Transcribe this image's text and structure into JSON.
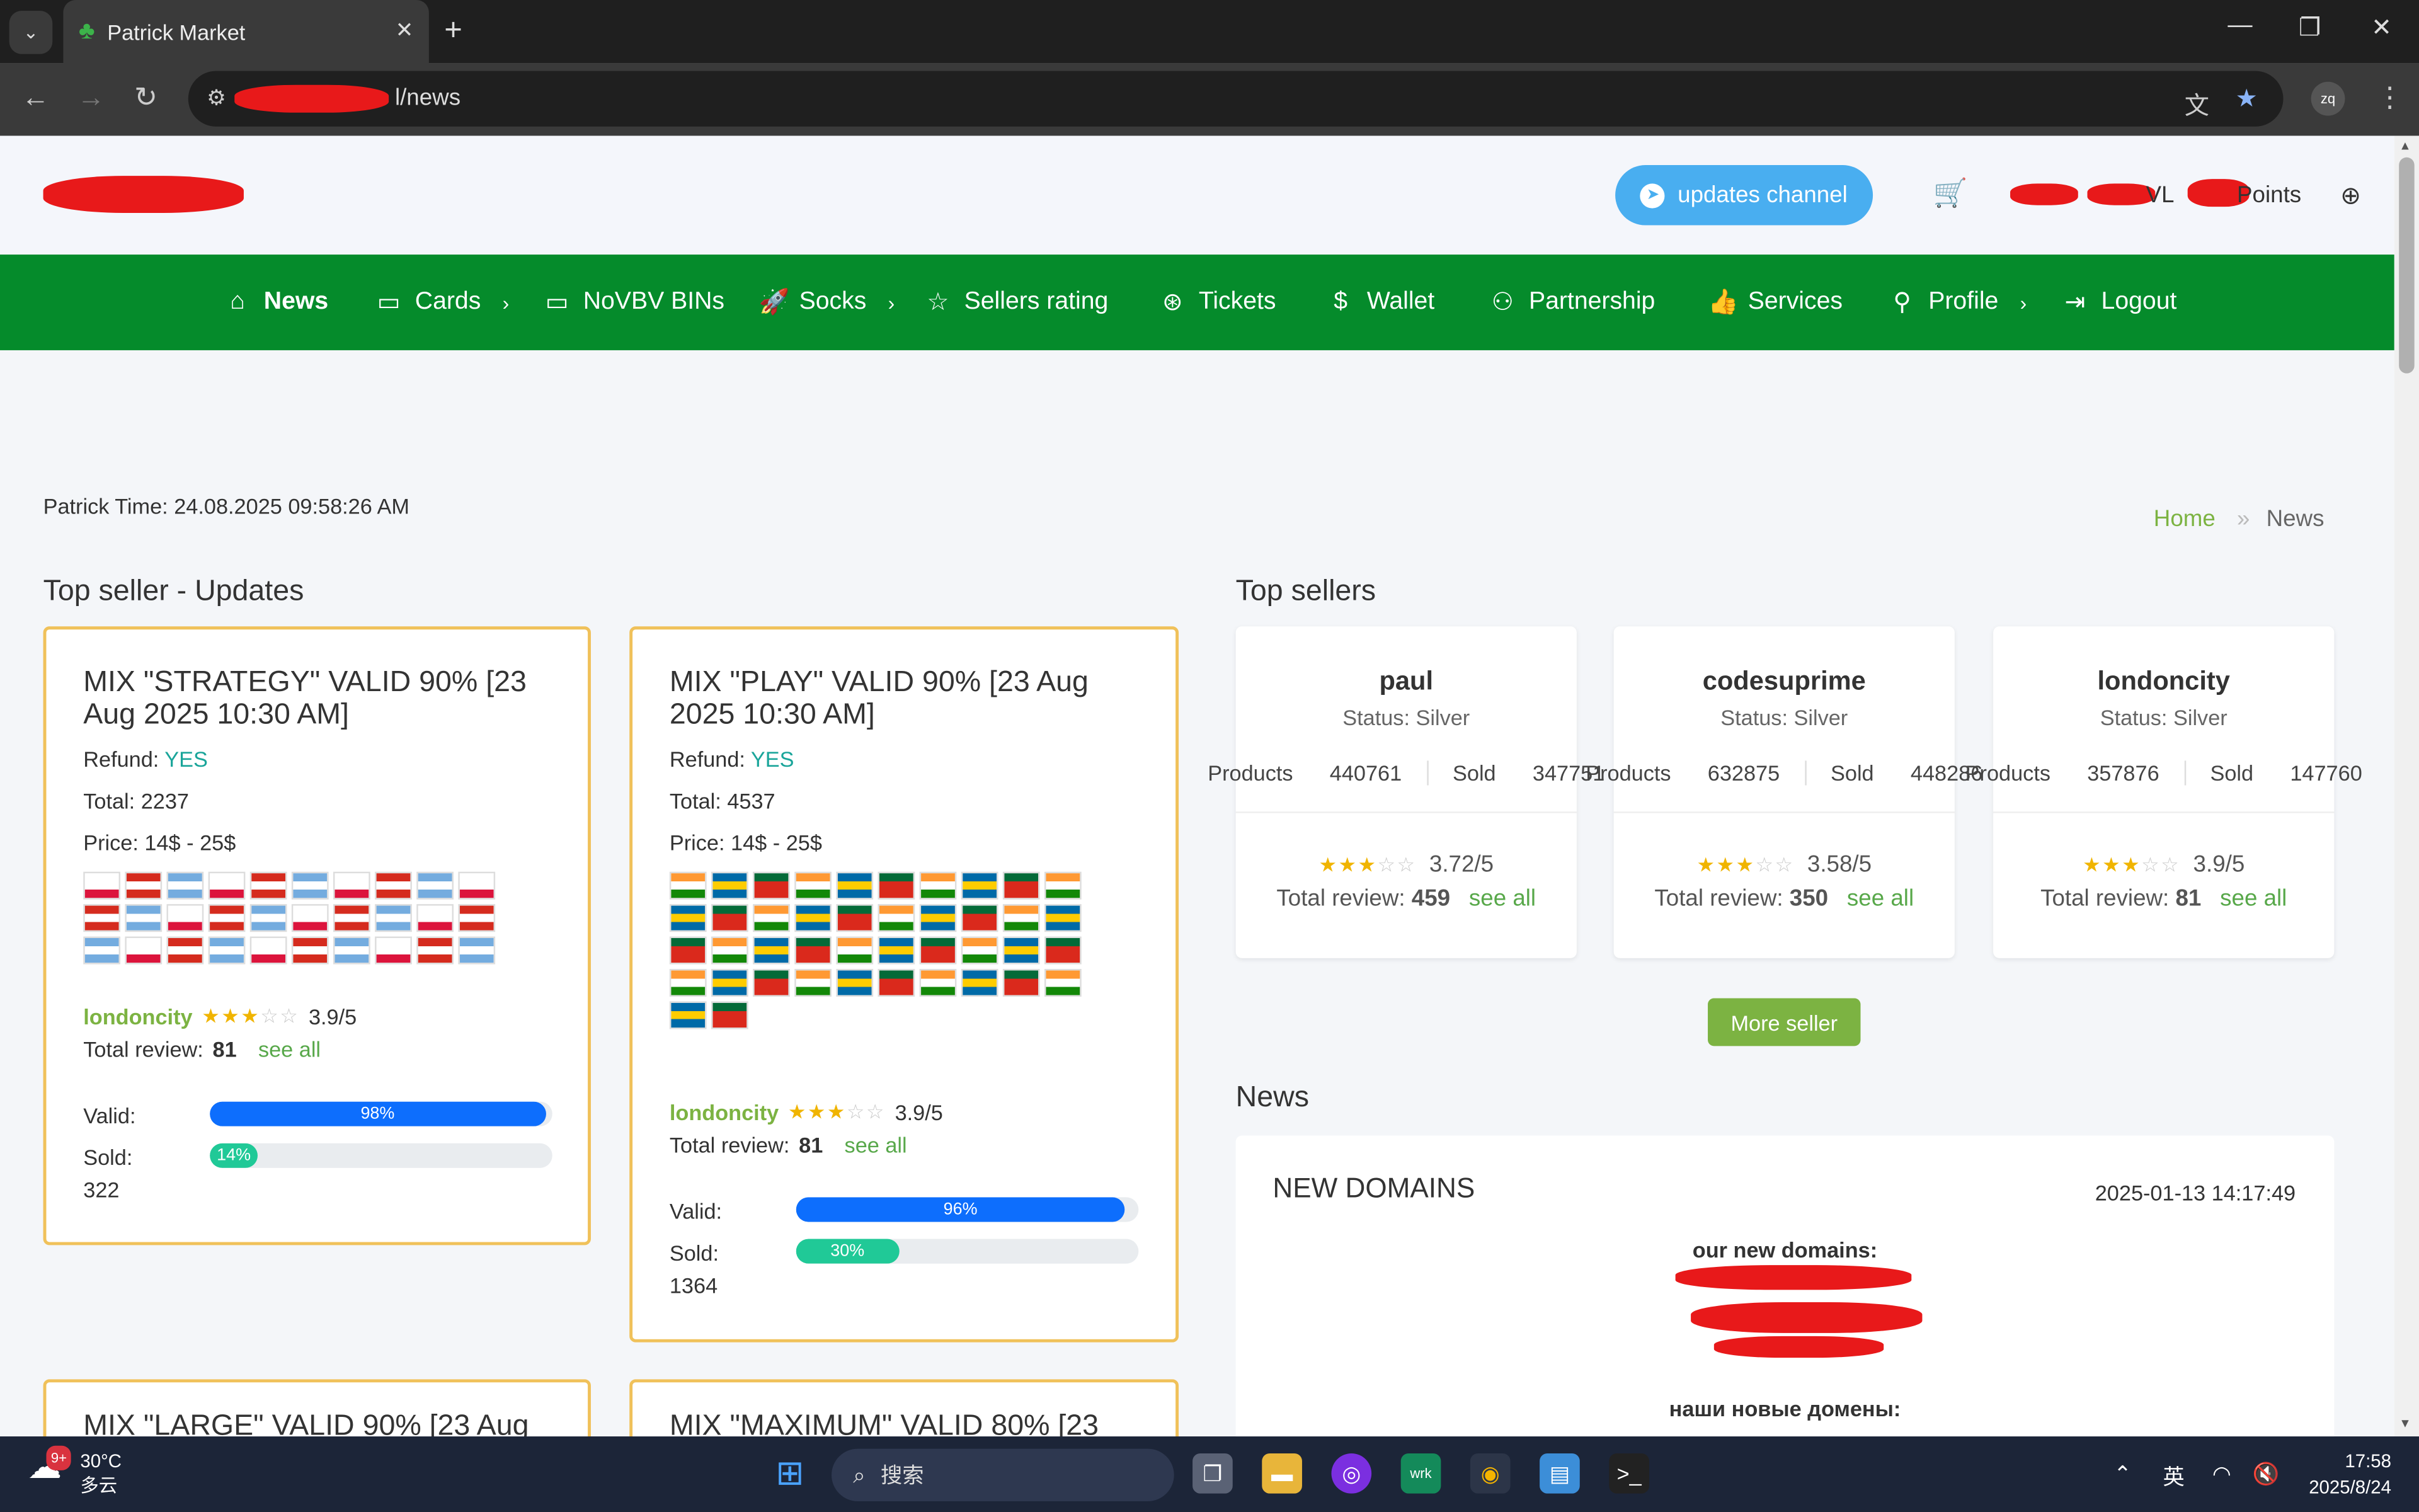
{
  "browser": {
    "tab_title": "Patrick Market",
    "url_suffix": "l/news",
    "profile_initials": "zq"
  },
  "header": {
    "updates_channel": "updates channel",
    "lvl_label": "VL",
    "points_label": "Points"
  },
  "nav": [
    {
      "label": "News",
      "icon": "home-icon"
    },
    {
      "label": "Cards",
      "icon": "card-icon"
    },
    {
      "label": "NoVBV BINs",
      "icon": "card-icon"
    },
    {
      "label": "Socks",
      "icon": "rocket-icon"
    },
    {
      "label": "Sellers rating",
      "icon": "star-icon"
    },
    {
      "label": "Tickets",
      "icon": "lifebuoy-icon"
    },
    {
      "label": "Wallet",
      "icon": "dollar-icon"
    },
    {
      "label": "Partnership",
      "icon": "users-icon"
    },
    {
      "label": "Services",
      "icon": "thumb-up-icon"
    },
    {
      "label": "Profile",
      "icon": "user-icon"
    },
    {
      "label": "Logout",
      "icon": "logout-icon"
    }
  ],
  "patrick_time": "Patrick Time: 24.08.2025 09:58:26 AM",
  "breadcrumb": {
    "home": "Home",
    "sep": "»",
    "current": "News"
  },
  "top_updates": {
    "title": "Top seller - Updates",
    "cards": [
      {
        "title": "MIX \"STRATEGY\" VALID 90% [23 Aug 2025 10:30 AM]",
        "refund_label": "Refund:",
        "refund_value": "YES",
        "total": "Total: 2237",
        "price": "Price: 14$ - 25$",
        "seller": "londoncity",
        "rating": "3.9/5",
        "review_label": "Total review:",
        "review_count": "81",
        "see_all": "see all",
        "valid_label": "Valid:",
        "valid_pct": 98,
        "valid_text": "98%",
        "sold_label": "Sold:",
        "sold_pct": 14,
        "sold_text": "14%",
        "sold_count": "322"
      },
      {
        "title": "MIX \"PLAY\" VALID 90% [23 Aug 2025 10:30 AM]",
        "refund_label": "Refund:",
        "refund_value": "YES",
        "total": "Total: 4537",
        "price": "Price: 14$ - 25$",
        "seller": "londoncity",
        "rating": "3.9/5",
        "review_label": "Total review:",
        "review_count": "81",
        "see_all": "see all",
        "valid_label": "Valid:",
        "valid_pct": 96,
        "valid_text": "96%",
        "sold_label": "Sold:",
        "sold_pct": 30,
        "sold_text": "30%",
        "sold_count": "1364"
      }
    ],
    "partial_titles": [
      "MIX \"LARGE\" VALID 90% [23 Aug",
      "MIX \"MAXIMUM\" VALID 80% [23"
    ]
  },
  "top_sellers": {
    "title": "Top sellers",
    "sellers": [
      {
        "name": "paul",
        "status": "Status: Silver",
        "products_label": "Products",
        "products": "440761",
        "sold_label": "Sold",
        "sold": "347751",
        "rating": "3.72/5",
        "review_label": "Total review:",
        "review_count": "459",
        "see_all": "see all"
      },
      {
        "name": "codesuprime",
        "status": "Status: Silver",
        "products_label": "Products",
        "products": "632875",
        "sold_label": "Sold",
        "sold": "448286",
        "rating": "3.58/5",
        "review_label": "Total review:",
        "review_count": "350",
        "see_all": "see all"
      },
      {
        "name": "londoncity",
        "status": "Status: Silver",
        "products_label": "Products",
        "products": "357876",
        "sold_label": "Sold",
        "sold": "147760",
        "rating": "3.9/5",
        "review_label": "Total review:",
        "review_count": "81",
        "see_all": "see all"
      }
    ],
    "more_button": "More seller"
  },
  "news": {
    "title": "News",
    "item": {
      "title": "NEW DOMAINS",
      "date": "2025-01-13 14:17:49",
      "line1": "our new domains:",
      "line2": "наши новые домены:"
    }
  },
  "taskbar": {
    "temp": "30°C",
    "weather": "多云",
    "badge": "9+",
    "search": "搜索",
    "ime": "英",
    "time": "17:58",
    "date": "2025/8/24"
  },
  "colors": {
    "nav_green": "#058b2b",
    "seller_green": "#7cb342",
    "card_border": "#f0c15a",
    "valid_bar": "#0d6efd",
    "sold_bar": "#20c997",
    "telegram": "#49aef0"
  }
}
